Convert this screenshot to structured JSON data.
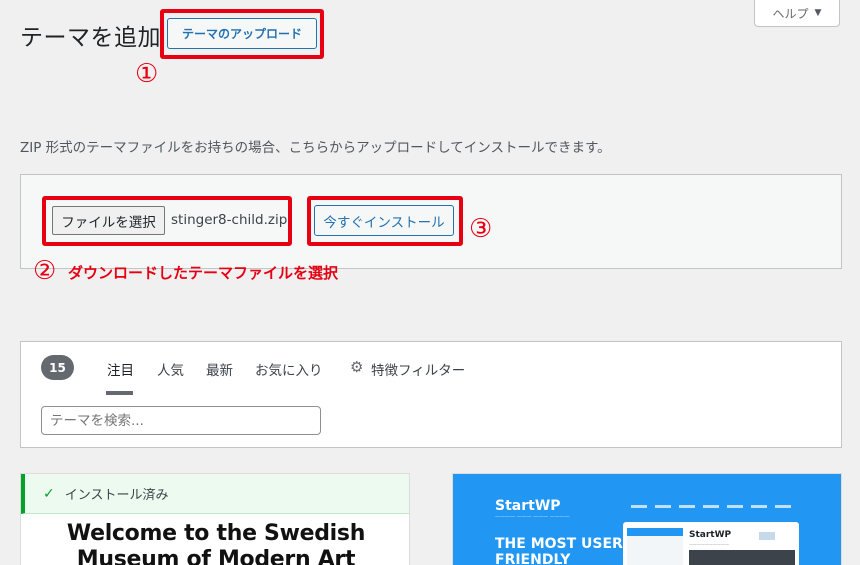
{
  "header": {
    "title": "テーマを追加",
    "upload_button": "テーマのアップロード",
    "help": "ヘルプ",
    "help_arrow": "▼"
  },
  "annotations": {
    "step1": "①",
    "step2": "②",
    "step2_text": "ダウンロードしたテーマファイルを選択",
    "step3": "③",
    "color": "#e60012"
  },
  "upload": {
    "description": "ZIP 形式のテーマファイルをお持ちの場合、こちらからアップロードしてインストールできます。",
    "choose_file": "ファイルを選択",
    "file_name": "stinger8-child.zip",
    "install_now": "今すぐインストール"
  },
  "filter": {
    "count": "15",
    "tabs": [
      {
        "label": "注目",
        "active": true
      },
      {
        "label": "人気",
        "active": false
      },
      {
        "label": "最新",
        "active": false
      },
      {
        "label": "お気に入り",
        "active": false
      },
      {
        "label": "特徴フィルター",
        "active": false,
        "icon": "gear-icon"
      }
    ],
    "search_placeholder": "テーマを検索..."
  },
  "themes": [
    {
      "installed_label": "インストール済み",
      "headline": "Welcome to the Swedish Museum of Modern Art"
    },
    {
      "logo": "StartWP",
      "headline": "THE MOST USER FRIENDLY",
      "mock_title": "StartWP"
    }
  ]
}
